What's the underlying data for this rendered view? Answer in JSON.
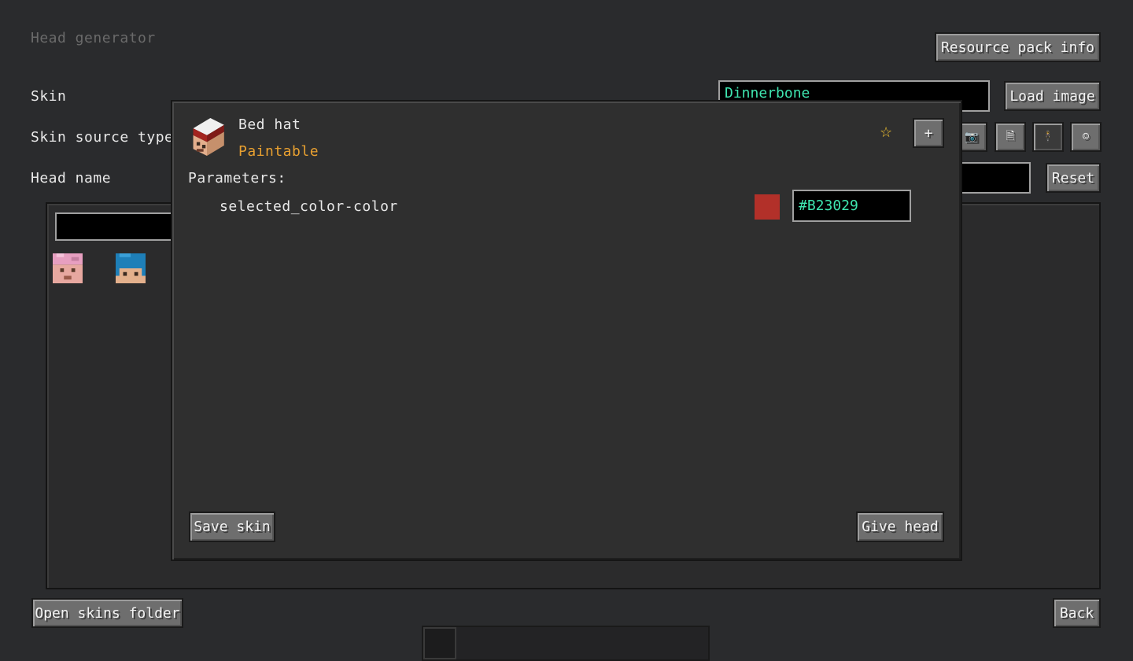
{
  "screen": {
    "title": "Head generator",
    "resource_pack_info": "Resource pack info",
    "skin_label": "Skin",
    "skin_value": "Dinnerbone",
    "load_image": "Load image",
    "skin_source_type_label": "Skin source type",
    "head_name_label": "Head name",
    "reset": "Reset",
    "open_skins_folder": "Open skins folder",
    "back": "Back",
    "source_icons": [
      "camera-icon",
      "document-icon",
      "person-icon",
      "smiley-icon"
    ],
    "source_glyphs": [
      "📷",
      "🗎",
      "🕴",
      "☺"
    ]
  },
  "dialog": {
    "name": "Bed hat",
    "type": "Paintable",
    "parameters_label": "Parameters:",
    "param_name": "selected_color-color",
    "color_hex": "#B23029",
    "color_swatch": "#b23029",
    "star": "☆",
    "add": "+",
    "save_skin": "Save skin",
    "give_head": "Give head"
  },
  "colors": {
    "accent_text": "#3fe6b0",
    "type_text": "#e8a030",
    "star": "#f2c230"
  }
}
